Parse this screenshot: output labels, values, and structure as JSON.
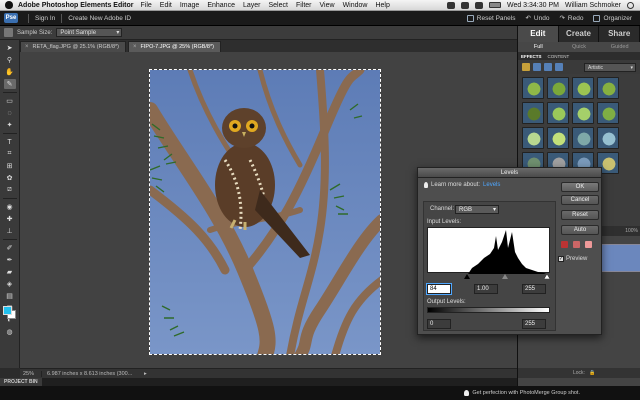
{
  "menubar": {
    "app_name": "Adobe Photoshop Elements Editor",
    "menus": [
      "File",
      "Edit",
      "Image",
      "Enhance",
      "Layer",
      "Select",
      "Filter",
      "View",
      "Window",
      "Help"
    ],
    "clock": "Wed 3:34:30 PM",
    "user": "William Schmoker"
  },
  "topbar": {
    "sign_in": "Sign In",
    "create_id": "Create New Adobe ID",
    "reset_panels": "Reset Panels",
    "undo": "Undo",
    "redo": "Redo",
    "organizer": "Organizer"
  },
  "options": {
    "sample_size_label": "Sample Size:",
    "sample_size_value": "Point Sample"
  },
  "tabs": [
    {
      "label": "RETA_flag.JPG @ 25.1% (RGB/8*)",
      "active": false
    },
    {
      "label": "FIPO-7.JPG @ 25% (RGB/8*)",
      "active": true
    }
  ],
  "status": {
    "zoom": "25%",
    "dims": "6.987 inches x 8.613 inches (300..."
  },
  "project_bin": "PROJECT BIN",
  "bottom_tip": "Get perfection with PhotoMerge Group shot.",
  "panel": {
    "modes": [
      "Edit",
      "Create",
      "Share"
    ],
    "submodes": [
      "Full",
      "Quick",
      "Guided"
    ],
    "effects_tabs": [
      "EFFECTS",
      "CONTENT"
    ],
    "filter_category": "Artistic",
    "layer_opacity_label": "100%",
    "lock_label": "Lock:"
  },
  "levels": {
    "title": "Levels",
    "learn_more": "Learn more about:",
    "learn_link": "Levels",
    "channel_label": "Channel:",
    "channel_value": "RGB",
    "input_label": "Input Levels:",
    "input_black": "84",
    "input_gamma": "1.00",
    "input_white": "255",
    "output_label": "Output Levels:",
    "output_black": "0",
    "output_white": "255",
    "buttons": {
      "ok": "OK",
      "cancel": "Cancel",
      "reset": "Reset",
      "auto": "Auto"
    },
    "preview_label": "Preview",
    "preview_checked": true
  },
  "colors": {
    "foreground": "#22c1ee",
    "background": "#ffffff",
    "link": "#4ea7ff",
    "sky": "#6b87bd"
  },
  "icons": {
    "undo": "undo-icon",
    "redo": "redo-icon",
    "organizer": "organizer-icon",
    "reset": "reset-panels-icon"
  }
}
